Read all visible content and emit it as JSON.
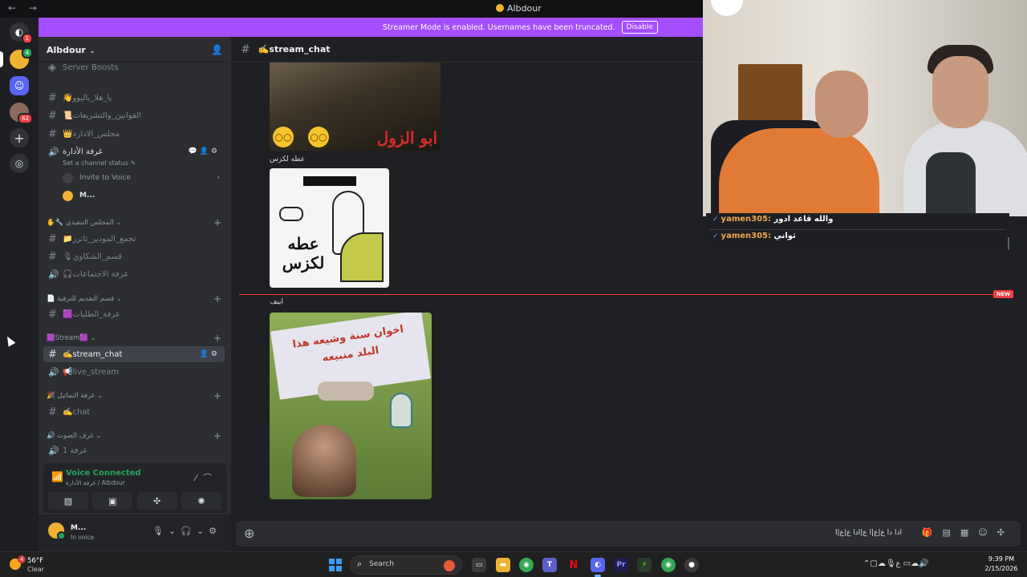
{
  "window": {
    "title": "Albdour",
    "nav": "← →"
  },
  "rail": {
    "dm_badge": "1",
    "server1_badge": "4",
    "server3_badge": "62"
  },
  "banner": {
    "text": "Streamer Mode is enabled. Usernames have been truncated.",
    "button": "Disable",
    "color": "#a54eff"
  },
  "guild": {
    "name": "Albdour"
  },
  "sidebar": {
    "boosts": "Server Boosts",
    "channels_top": [
      {
        "label": "👋يا_هلا_باليوو"
      },
      {
        "label": "📜القوانين_والتشريعات"
      },
      {
        "label": "👑مجلس_الادارة"
      }
    ],
    "voice_admin": {
      "label": "غرفة الأدارة",
      "status": "Set a channel status ✎"
    },
    "invite": "Invite to Voice",
    "voice_user": "M...",
    "cat1": "✋🔧 المجلس التنفيذي ⌄",
    "cat1_channels": [
      {
        "label": "📁تجمع_المودير_تاترز"
      },
      {
        "label": "🎙قسم_الشكاوي"
      },
      {
        "label": "🎧غرفة الاجتماعات"
      }
    ],
    "cat2": "📄 قسم التقديم للترقية ⌄",
    "cat2_channels": [
      {
        "label": "🟪غرفة_الطلبات"
      }
    ],
    "cat3": "🟪Stream🟪 ⌄",
    "cat3_channels": [
      {
        "label": "✍️stream_chat"
      },
      {
        "label": "📢live_stream"
      }
    ],
    "cat4": "🎉 غرفة التماثيل ⌄",
    "cat4_channels": [
      {
        "label": "✍️chat"
      }
    ],
    "cat5": "🔊 غرف الصوت ⌄",
    "cat5_channels": [
      {
        "label": "غرفة 1"
      }
    ]
  },
  "voice_panel": {
    "status": "Voice Connected",
    "location": "غرفة الأدارة / Albdour"
  },
  "user_panel": {
    "name": "M...",
    "status": "In voice"
  },
  "channel": {
    "name": "✍️stream_chat"
  },
  "messages": [
    {
      "image_caption": "ابو الزول",
      "text": "عطه لكزس"
    },
    {
      "image_caption": "عطه لكزس"
    },
    {
      "text": "ابيف",
      "image_caption": "اخوان سنة وشيعه هذا البلد منبيعه"
    }
  ],
  "divider": {
    "badge": "NEW"
  },
  "composer": {
    "text": "ادا دا ع|ع|ا ع|ادا ع|ع|ا"
  },
  "stream_chat": [
    {
      "user": "yamen305:",
      "msg": "والله قاعد ادور"
    },
    {
      "user": "yamen305:",
      "msg": "ثواني"
    }
  ],
  "taskbar": {
    "weather_temp": "56°F",
    "weather_cond": "Clear",
    "weather_badge": "4",
    "search": "Search",
    "time": "9:39 PM",
    "date": "2/15/2026"
  }
}
